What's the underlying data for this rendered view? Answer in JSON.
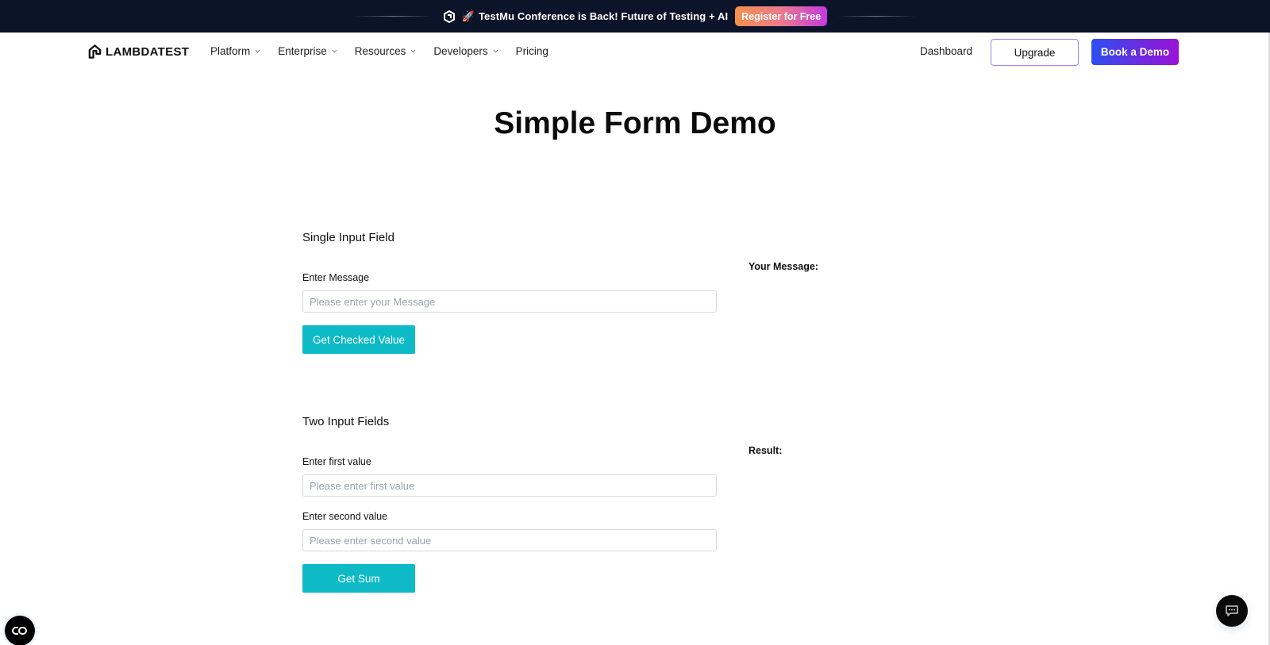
{
  "banner": {
    "icon": "testmu-logo-icon",
    "emoji": "🚀",
    "text": "TestMu Conference is Back! Future of Testing + AI",
    "cta_label": "Register for Free"
  },
  "nav": {
    "logo_text": "LAMBDATEST",
    "menu": [
      {
        "label": "Platform",
        "dropdown": true
      },
      {
        "label": "Enterprise",
        "dropdown": true
      },
      {
        "label": "Resources",
        "dropdown": true
      },
      {
        "label": "Developers",
        "dropdown": true
      },
      {
        "label": "Pricing",
        "dropdown": false
      }
    ],
    "dashboard_label": "Dashboard",
    "upgrade_label": "Upgrade",
    "demo_label": "Book a Demo"
  },
  "page": {
    "title": "Simple Form Demo"
  },
  "single_input": {
    "section_title": "Single Input Field",
    "label": "Enter Message",
    "placeholder": "Please enter your Message",
    "value": "",
    "button_label": "Get Checked Value",
    "output_label": "Your Message:",
    "output_value": ""
  },
  "two_inputs": {
    "section_title": "Two Input Fields",
    "first_label": "Enter first value",
    "first_placeholder": "Please enter first value",
    "second_label": "Enter second value",
    "second_placeholder": "Please enter second value",
    "button_label": "Get Sum",
    "output_label": "Result:",
    "output_value": ""
  },
  "floating": {
    "left_icon": "accessibility-toggle-icon",
    "right_icon": "chat-icon"
  },
  "colors": {
    "banner_bg": "#0c142a",
    "accent_teal": "#0ebac5",
    "demo_gradient_start": "#2d4ff0",
    "demo_gradient_end": "#9a12d8"
  }
}
